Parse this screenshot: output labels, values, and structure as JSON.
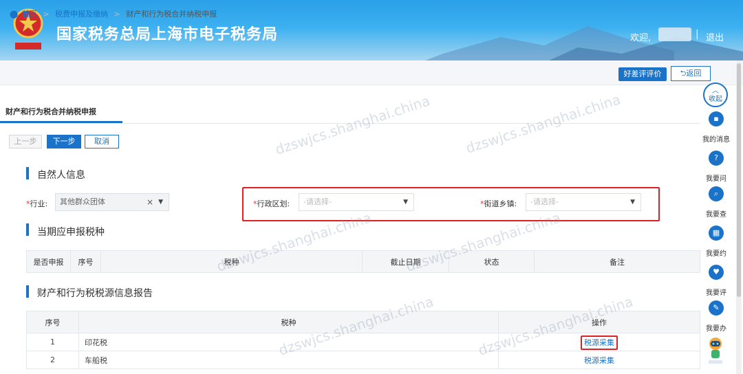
{
  "header": {
    "site_title": "国家税务总局上海市电子税务局",
    "welcome": "欢迎,",
    "separator": "|",
    "logout": "退出",
    "colors": {
      "header_top": "#2aa0e8",
      "accent": "#1a73c8",
      "highlight": "#e02020"
    }
  },
  "breadcrumb": {
    "home": "首页",
    "level1": "税费申报及缴纳",
    "current": "财产和行为税合并纳税申报",
    "arrow": ">"
  },
  "actions": {
    "rate": "好差评评价",
    "back": "返回"
  },
  "tab": {
    "label": "财产和行为税合并纳税申报"
  },
  "steps": {
    "prev": "上一步",
    "next": "下一步",
    "cancel": "取消"
  },
  "person_info": {
    "title": "自然人信息",
    "industry_label": "行业:",
    "industry_value": "其他群众团体",
    "region_label": "行政区划:",
    "region_placeholder": "-请选择-",
    "street_label": "街道乡镇:",
    "street_placeholder": "-请选择-",
    "required_mark": "*"
  },
  "tax_due": {
    "title": "当期应申报税种",
    "columns": [
      "是否申报",
      "序号",
      "税种",
      "截止日期",
      "状态",
      "备注"
    ]
  },
  "tax_source": {
    "title": "财产和行为税税源信息报告",
    "columns": [
      "序号",
      "税种",
      "操作"
    ],
    "rows": [
      {
        "no": "1",
        "tax": "印花税",
        "action": "税源采集"
      },
      {
        "no": "2",
        "tax": "车船税",
        "action": "税源采集"
      }
    ]
  },
  "sidebar": {
    "collapse": "收起",
    "items": [
      {
        "label": "我的消息",
        "icon": "message-icon"
      },
      {
        "label": "我要问",
        "icon": "question-icon"
      },
      {
        "label": "我要查",
        "icon": "search-icon"
      },
      {
        "label": "我要约",
        "icon": "calendar-icon"
      },
      {
        "label": "我要评",
        "icon": "review-icon"
      },
      {
        "label": "我要办",
        "icon": "edit-icon"
      }
    ]
  },
  "watermark": "dzswjcs.shanghai.china"
}
